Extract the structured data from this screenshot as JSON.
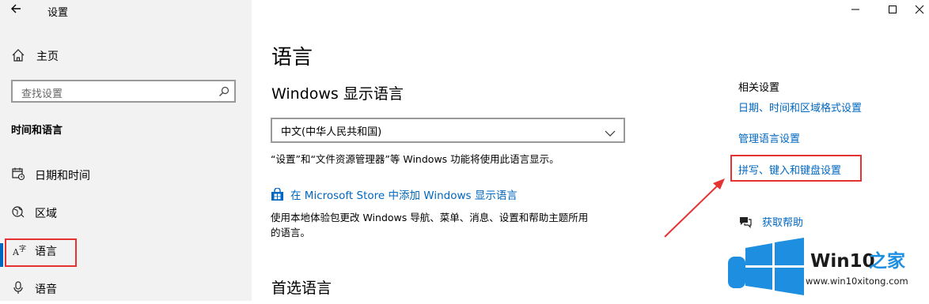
{
  "window": {
    "title": "设置",
    "minimize_icon": "—",
    "maximize_icon": "☐",
    "close_icon": "✕"
  },
  "sidebar": {
    "home_label": "主页",
    "search_placeholder": "查找设置",
    "category": "时间和语言",
    "items": [
      {
        "label": "日期和时间",
        "icon": "calendar-clock-icon"
      },
      {
        "label": "区域",
        "icon": "globe-icon"
      },
      {
        "label": "语言",
        "icon": "language-icon",
        "selected": true
      },
      {
        "label": "语音",
        "icon": "microphone-icon"
      }
    ]
  },
  "main": {
    "title": "语言",
    "display_language_heading": "Windows 显示语言",
    "display_language_value": "中文(中华人民共和国)",
    "display_language_desc": "“设置”和“文件资源管理器”等 Windows 功能将使用此语言显示。",
    "store_link": "在 Microsoft Store 中添加 Windows 显示语言",
    "store_desc_line1": "使用本地体验包更改 Windows 导航、菜单、消息、设置和帮助主题所用",
    "store_desc_line2": "的语言。",
    "preferred_heading": "首选语言"
  },
  "related": {
    "title": "相关设置",
    "links": [
      "日期、时间和区域格式设置",
      "管理语言设置",
      "拼写、键入和键盘设置"
    ],
    "help": "获取帮助"
  },
  "watermark": {
    "brand": "Win10",
    "brand_suffix": "之家",
    "url": "www.win10xitong.com"
  },
  "colors": {
    "accent": "#0067c0",
    "highlight": "#e53333",
    "sidebar_bg": "#f2f2f2"
  }
}
